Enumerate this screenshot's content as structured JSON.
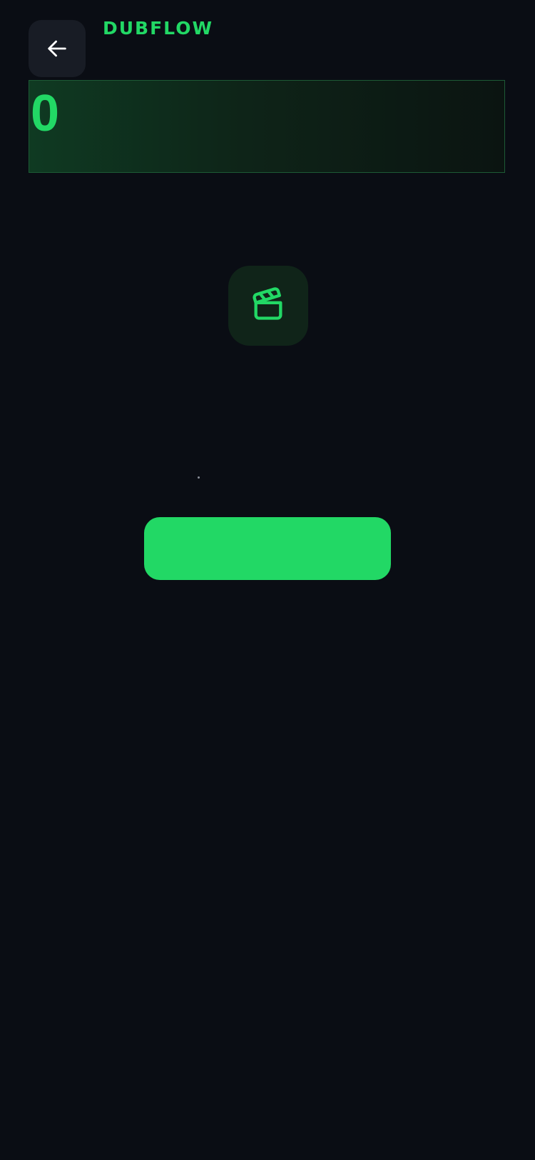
{
  "header": {
    "brand": "DUBFLOW",
    "back_icon": "arrow-left-icon"
  },
  "counter": {
    "value": "0"
  },
  "media_tile": {
    "icon": "clapperboard-icon"
  },
  "primary_action": {
    "label": ""
  },
  "colors": {
    "background": "#0a0d14",
    "accent": "#22d865",
    "tile": "#102419",
    "back_button": "#181c25"
  }
}
